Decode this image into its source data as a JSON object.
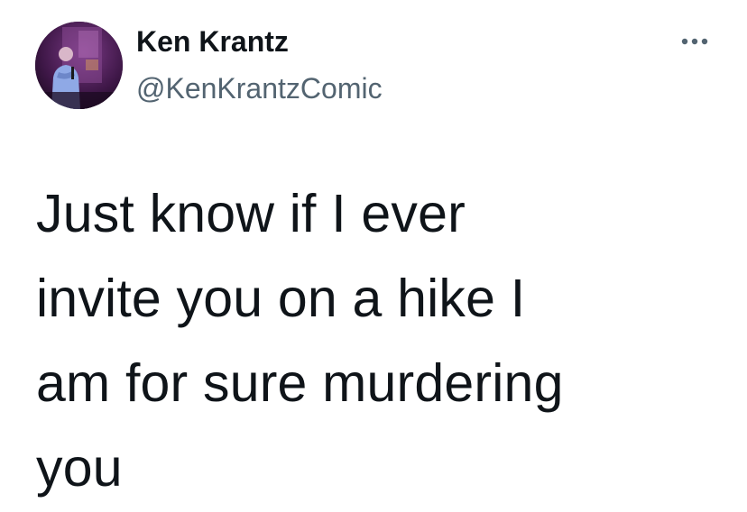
{
  "tweet": {
    "author": {
      "display_name": "Ken Krantz",
      "handle": "@KenKrantzComic",
      "avatar_icon": "profile-photo-comedian-on-stage"
    },
    "more_icon": "more-options-ellipsis-icon",
    "text": "Just know if I ever\ninvite you on a hike I\nam for sure murdering\nyou"
  },
  "colors": {
    "text_primary": "#0f1419",
    "text_secondary": "#536471",
    "background": "#ffffff"
  }
}
